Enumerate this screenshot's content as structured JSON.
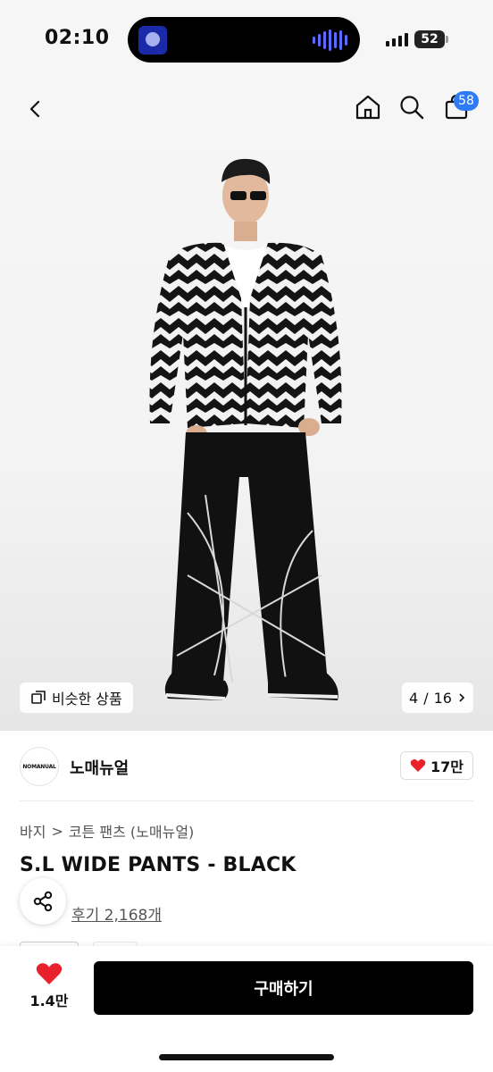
{
  "status_bar": {
    "time": "02:10",
    "battery": "52"
  },
  "header": {
    "cart_count": "58"
  },
  "hero": {
    "similar_label": "비슷한 상품",
    "page_current": "4",
    "page_total": "16",
    "page_separator": "/"
  },
  "brand": {
    "logo_text": "NOMANUAL",
    "name": "노매뉴얼",
    "likes": "17만",
    "heart_color": "#e8212c"
  },
  "breadcrumb": {
    "items": [
      "바지",
      "코튼 팬츠 (노매뉴얼)"
    ],
    "separator": ">"
  },
  "product": {
    "title": "S.L WIDE PANTS - BLACK",
    "review_link": "후기 2,168개"
  },
  "bottom_bar": {
    "wish_count": "1.4만",
    "buy_label": "구매하기"
  },
  "colors": {
    "accent_badge": "#2f7bf5",
    "buy_button": "#000000"
  }
}
